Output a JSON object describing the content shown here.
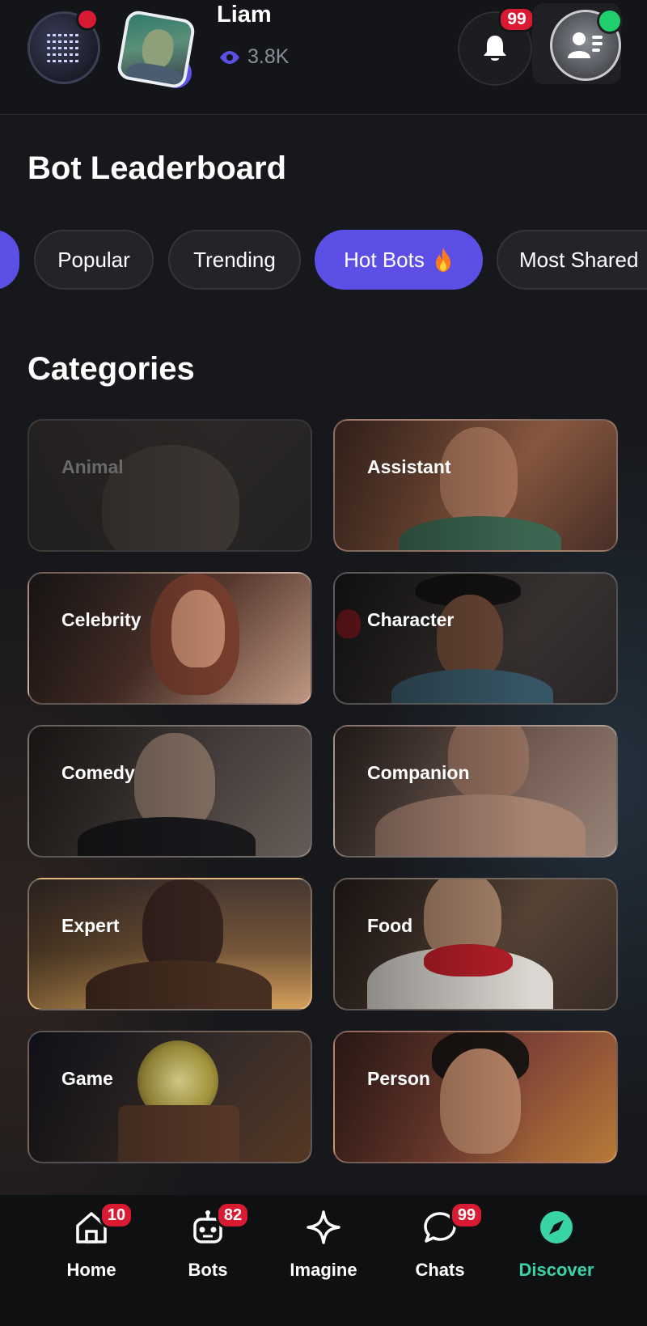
{
  "header": {
    "user_name": "Liam",
    "views": "3.8K",
    "notification_badge": "99"
  },
  "leaderboard": {
    "title": "Bot Leaderboard",
    "chips": [
      {
        "label": "Popular",
        "active": false
      },
      {
        "label": "Trending",
        "active": false
      },
      {
        "label": "Hot Bots",
        "icon": "fire-icon",
        "active": true
      },
      {
        "label": "Most Shared",
        "active": false
      }
    ]
  },
  "categories": {
    "title": "Categories",
    "items": [
      {
        "label": "Animal"
      },
      {
        "label": "Assistant"
      },
      {
        "label": "Celebrity"
      },
      {
        "label": "Character"
      },
      {
        "label": "Comedy"
      },
      {
        "label": "Companion"
      },
      {
        "label": "Expert"
      },
      {
        "label": "Food"
      },
      {
        "label": "Game"
      },
      {
        "label": "Person"
      }
    ]
  },
  "nav": {
    "items": [
      {
        "label": "Home",
        "icon": "home-icon",
        "badge": "10"
      },
      {
        "label": "Bots",
        "icon": "bot-icon",
        "badge": "82"
      },
      {
        "label": "Imagine",
        "icon": "sparkle-icon",
        "badge": ""
      },
      {
        "label": "Chats",
        "icon": "chat-bubble-icon",
        "badge": "99"
      },
      {
        "label": "Discover",
        "icon": "compass-icon",
        "badge": "",
        "active": true
      }
    ]
  },
  "colors": {
    "accent": "#5b4fe6",
    "discover_active": "#38d4a3",
    "badge_red": "#d81b33",
    "online_green": "#1fcf6b"
  }
}
